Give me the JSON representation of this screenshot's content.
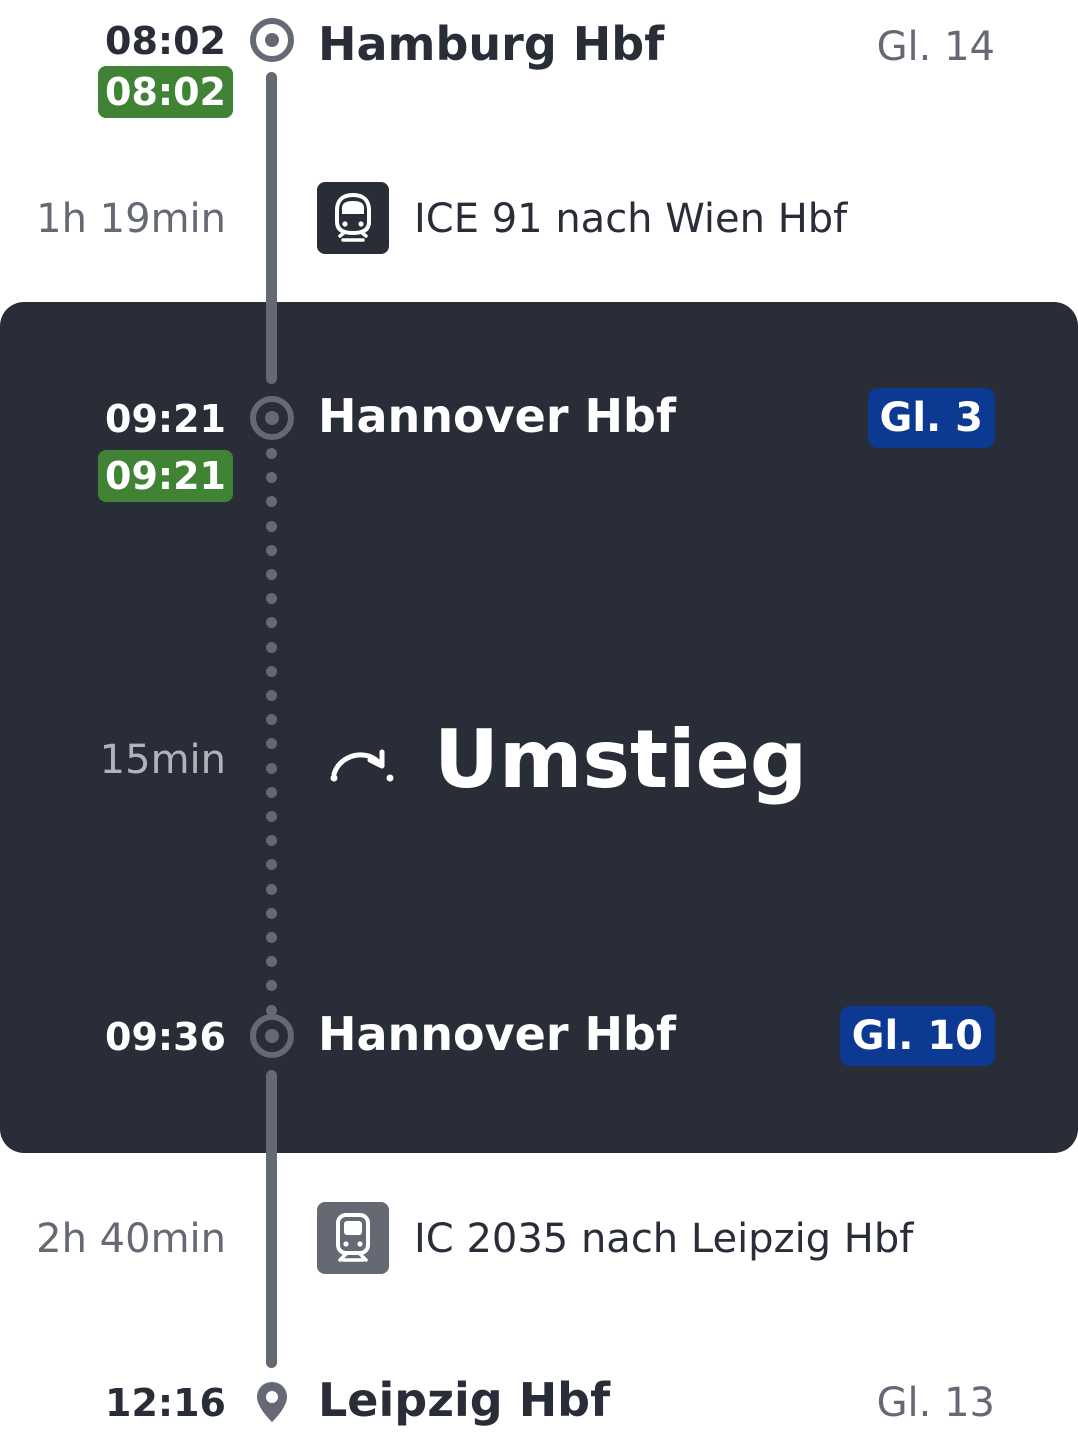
{
  "journey": {
    "start": {
      "time_planned": "08:02",
      "time_realtime": "08:02",
      "station": "Hamburg Hbf",
      "platform": "Gl. 14"
    },
    "leg1": {
      "duration": "1h 19min",
      "train": "ICE 91 nach Wien Hbf",
      "icon": "ice-train-icon"
    },
    "transfer": {
      "arrival": {
        "time_planned": "09:21",
        "time_realtime": "09:21",
        "station": "Hannover Hbf",
        "platform": "Gl. 3"
      },
      "duration": "15min",
      "label": "Umstieg",
      "departure": {
        "time_planned": "09:36",
        "station": "Hannover Hbf",
        "platform": "Gl. 10"
      }
    },
    "leg2": {
      "duration": "2h 40min",
      "train": "IC 2035 nach Leipzig Hbf",
      "icon": "ic-train-icon"
    },
    "end": {
      "time_planned": "12:16",
      "station": "Leipzig Hbf",
      "platform": "Gl. 13"
    }
  },
  "colors": {
    "card_background": "#282d37",
    "timeline": "#646973",
    "realtime_green": "#408335",
    "platform_changed_blue": "#0c3992",
    "text_primary": "#282d37",
    "text_secondary": "#646973"
  }
}
